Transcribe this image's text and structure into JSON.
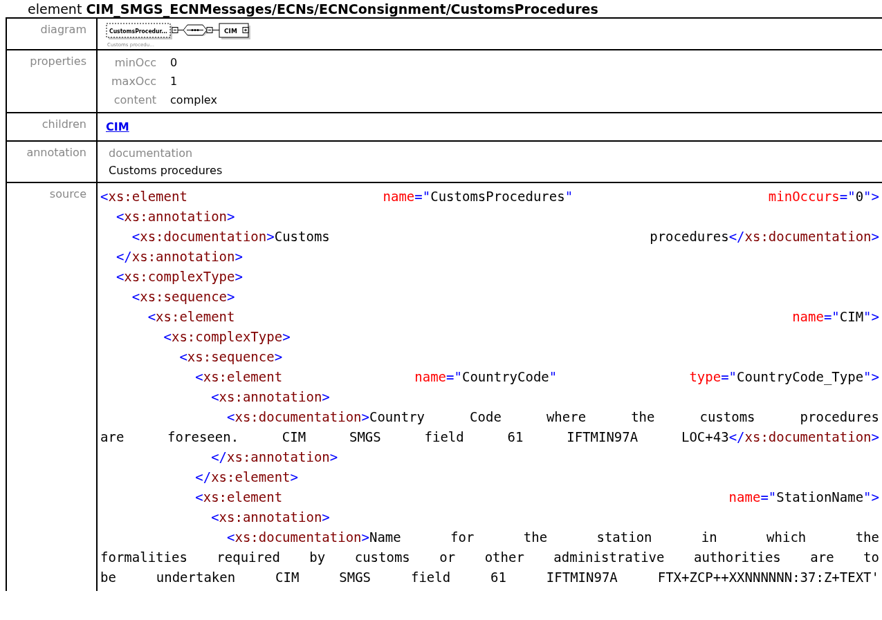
{
  "title": {
    "prefix": "element",
    "path": "CIM_SMGS_ECNMessages/ECNs/ECNConsignment/CustomsProcedures"
  },
  "diagram": {
    "label": "diagram",
    "element": "CustomsProcedur...",
    "caption": "Customs procedu...",
    "child": "CIM"
  },
  "properties": {
    "label": "properties",
    "items": [
      {
        "name": "minOcc",
        "value": "0"
      },
      {
        "name": "maxOcc",
        "value": "1"
      },
      {
        "name": "content",
        "value": "complex"
      }
    ]
  },
  "children": {
    "label": "children",
    "links": [
      "CIM"
    ]
  },
  "annotation": {
    "label": "annotation",
    "heading": "documentation",
    "text": "Customs procedures"
  },
  "source": {
    "label": "source",
    "lines": [
      {
        "justify": true,
        "tokens": [
          {
            "kind": "p",
            "text": "<"
          },
          {
            "kind": "n",
            "text": "xs:element "
          },
          {
            "kind": "a",
            "text": "name"
          },
          {
            "kind": "p",
            "text": "=\""
          },
          {
            "kind": "v",
            "text": "CustomsProcedures"
          },
          {
            "kind": "p",
            "text": "\" "
          },
          {
            "kind": "a",
            "text": "minOccurs"
          },
          {
            "kind": "p",
            "text": "=\""
          },
          {
            "kind": "v",
            "text": "0"
          },
          {
            "kind": "p",
            "text": "\">"
          }
        ]
      },
      {
        "tokens": [
          {
            "kind": "p",
            "text": "  <"
          },
          {
            "kind": "n",
            "text": "xs:annotation"
          },
          {
            "kind": "p",
            "text": ">"
          }
        ]
      },
      {
        "justify": true,
        "tokens": [
          {
            "kind": "p",
            "text": "    <"
          },
          {
            "kind": "n",
            "text": "xs:documentation"
          },
          {
            "kind": "p",
            "text": ">"
          },
          {
            "kind": "t",
            "text": "Customs procedures"
          },
          {
            "kind": "p",
            "text": "</"
          },
          {
            "kind": "n",
            "text": "xs:documentation"
          },
          {
            "kind": "p",
            "text": ">"
          }
        ]
      },
      {
        "tokens": [
          {
            "kind": "p",
            "text": "  </"
          },
          {
            "kind": "n",
            "text": "xs:annotation"
          },
          {
            "kind": "p",
            "text": ">"
          }
        ]
      },
      {
        "tokens": [
          {
            "kind": "p",
            "text": "  <"
          },
          {
            "kind": "n",
            "text": "xs:complexType"
          },
          {
            "kind": "p",
            "text": ">"
          }
        ]
      },
      {
        "tokens": [
          {
            "kind": "p",
            "text": "    <"
          },
          {
            "kind": "n",
            "text": "xs:sequence"
          },
          {
            "kind": "p",
            "text": ">"
          }
        ]
      },
      {
        "justify": true,
        "tokens": [
          {
            "kind": "p",
            "text": "      <"
          },
          {
            "kind": "n",
            "text": "xs:element "
          },
          {
            "kind": "a",
            "text": "name"
          },
          {
            "kind": "p",
            "text": "=\""
          },
          {
            "kind": "v",
            "text": "CIM"
          },
          {
            "kind": "p",
            "text": "\">"
          }
        ]
      },
      {
        "tokens": [
          {
            "kind": "p",
            "text": "        <"
          },
          {
            "kind": "n",
            "text": "xs:complexType"
          },
          {
            "kind": "p",
            "text": ">"
          }
        ]
      },
      {
        "tokens": [
          {
            "kind": "p",
            "text": "          <"
          },
          {
            "kind": "n",
            "text": "xs:sequence"
          },
          {
            "kind": "p",
            "text": ">"
          }
        ]
      },
      {
        "justify": true,
        "tokens": [
          {
            "kind": "p",
            "text": "            <"
          },
          {
            "kind": "n",
            "text": "xs:element "
          },
          {
            "kind": "a",
            "text": "name"
          },
          {
            "kind": "p",
            "text": "=\""
          },
          {
            "kind": "v",
            "text": "CountryCode"
          },
          {
            "kind": "p",
            "text": "\" "
          },
          {
            "kind": "a",
            "text": "type"
          },
          {
            "kind": "p",
            "text": "=\""
          },
          {
            "kind": "v",
            "text": "CountryCode_Type"
          },
          {
            "kind": "p",
            "text": "\">"
          }
        ]
      },
      {
        "tokens": [
          {
            "kind": "p",
            "text": "              <"
          },
          {
            "kind": "n",
            "text": "xs:annotation"
          },
          {
            "kind": "p",
            "text": ">"
          }
        ]
      },
      {
        "justify": true,
        "tokens": [
          {
            "kind": "p",
            "text": "                <"
          },
          {
            "kind": "n",
            "text": "xs:documentation"
          },
          {
            "kind": "p",
            "text": ">"
          },
          {
            "kind": "t",
            "text": "Country Code where the customs procedures"
          }
        ]
      },
      {
        "justify": true,
        "tokens": [
          {
            "kind": "t",
            "text": "are foreseen. CIM SMGS field 61 IFTMIN97A LOC+43"
          },
          {
            "kind": "p",
            "text": "</"
          },
          {
            "kind": "n",
            "text": "xs:documentation"
          },
          {
            "kind": "p",
            "text": ">"
          }
        ]
      },
      {
        "tokens": [
          {
            "kind": "p",
            "text": "              </"
          },
          {
            "kind": "n",
            "text": "xs:annotation"
          },
          {
            "kind": "p",
            "text": ">"
          }
        ]
      },
      {
        "tokens": [
          {
            "kind": "p",
            "text": "            </"
          },
          {
            "kind": "n",
            "text": "xs:element"
          },
          {
            "kind": "p",
            "text": ">"
          }
        ]
      },
      {
        "justify": true,
        "tokens": [
          {
            "kind": "p",
            "text": "            <"
          },
          {
            "kind": "n",
            "text": "xs:element "
          },
          {
            "kind": "a",
            "text": "name"
          },
          {
            "kind": "p",
            "text": "=\""
          },
          {
            "kind": "v",
            "text": "StationName"
          },
          {
            "kind": "p",
            "text": "\">"
          }
        ]
      },
      {
        "tokens": [
          {
            "kind": "p",
            "text": "              <"
          },
          {
            "kind": "n",
            "text": "xs:annotation"
          },
          {
            "kind": "p",
            "text": ">"
          }
        ]
      },
      {
        "justify": true,
        "tokens": [
          {
            "kind": "p",
            "text": "                <"
          },
          {
            "kind": "n",
            "text": "xs:documentation"
          },
          {
            "kind": "p",
            "text": ">"
          },
          {
            "kind": "t",
            "text": "Name for the station in which the"
          }
        ]
      },
      {
        "justify": true,
        "tokens": [
          {
            "kind": "t",
            "text": "formalities required by customs or other administrative authorities are to"
          }
        ]
      },
      {
        "justify": true,
        "tokens": [
          {
            "kind": "t",
            "text": "be undertaken CIM SMGS field 61 IFTMIN97A FTX+ZCP++XXNNNNNN:37:Z+TEXT'"
          }
        ]
      }
    ]
  }
}
